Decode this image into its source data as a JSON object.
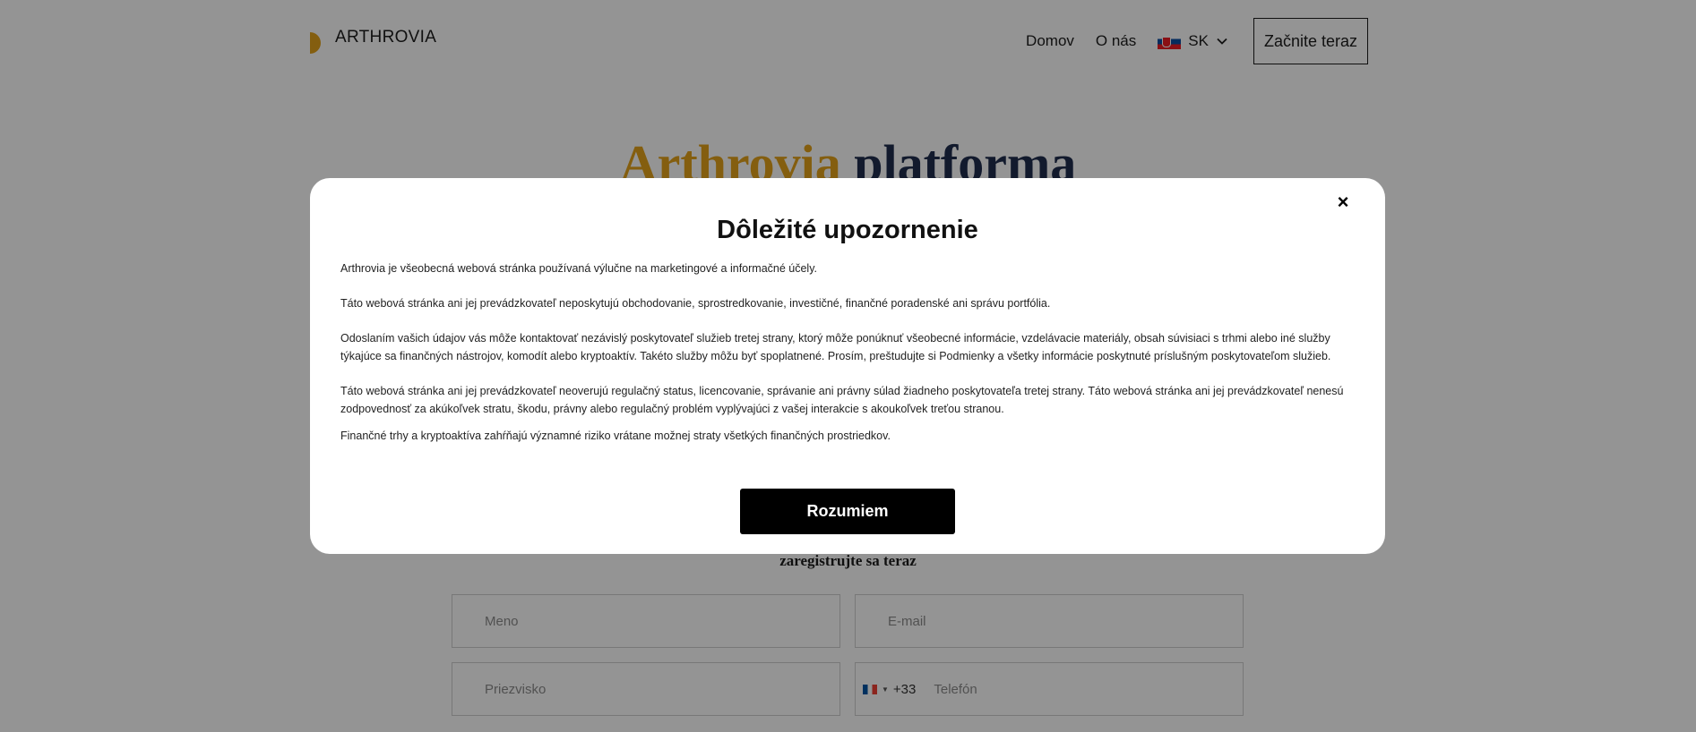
{
  "header": {
    "logo_text": "ARTHROVIA",
    "nav": [
      {
        "label": "Domov"
      },
      {
        "label": "O nás"
      }
    ],
    "language": {
      "code": "SK"
    },
    "cta_label": "Začnite teraz"
  },
  "hero": {
    "title_accent": "Arthrovia",
    "title_rest": "platforma",
    "subtitle": ""
  },
  "form": {
    "register_label": "zaregistrujte sa teraz",
    "name_placeholder": "Meno",
    "email_placeholder": "E-mail",
    "surname_placeholder": "Priezvisko",
    "phone_code": "+33",
    "phone_placeholder": "Telefón"
  },
  "modal": {
    "close_symbol": "×",
    "title": "Dôležité upozornenie",
    "paragraphs": [
      "Arthrovia je všeobecná webová stránka používaná výlučne na marketingové a informačné účely.",
      "Táto webová stránka ani jej prevádzkovateľ neposkytujú obchodovanie, sprostredkovanie, investičné, finančné poradenské ani správu portfólia.",
      "Odoslaním vašich údajov vás môže kontaktovať nezávislý poskytovateľ služieb tretej strany, ktorý môže ponúknuť všeobecné informácie, vzdelávacie materiály, obsah súvisiaci s trhmi alebo iné služby týkajúce sa finančných nástrojov, komodít alebo kryptoaktív. Takéto služby môžu byť spoplatnené. Prosím, preštudujte si Podmienky a všetky informácie poskytnuté príslušným poskytovateľom služieb.",
      "Táto webová stránka ani jej prevádzkovateľ neoverujú regulačný status, licencovanie, správanie ani právny súlad žiadneho poskytovateľa tretej strany. Táto webová stránka ani jej prevádzkovateľ nenesú zodpovednosť za akúkoľvek stratu, škodu, právny alebo regulačný problém vyplývajúci z vašej interakcie s akoukoľvek treťou stranou.",
      "Finančné trhy a kryptoaktíva zahŕňajú významné riziko vrátane možnej straty všetkých finančných prostriedkov."
    ],
    "button_label": "Rozumiem"
  },
  "colors": {
    "accent": "#e3a21a",
    "navy": "#1f2d4e",
    "button": "#000000",
    "overlay": "rgba(0,0,0,0.42)"
  }
}
